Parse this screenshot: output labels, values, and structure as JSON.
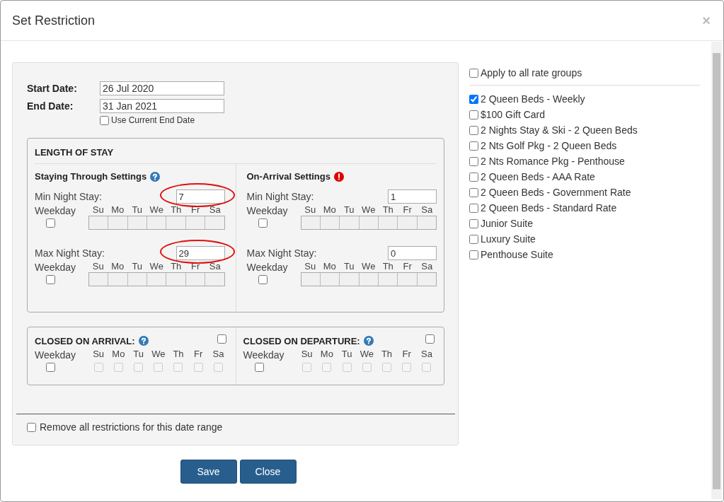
{
  "dialog": {
    "title": "Set Restriction",
    "close": "×"
  },
  "dates": [
    {
      "label": "Start Date:",
      "value": "26 Jul 2020"
    },
    {
      "label": "End Date:",
      "value": "31 Jan 2021"
    }
  ],
  "use_current_end_date": {
    "label": "Use Current End Date",
    "checked": false
  },
  "length_of_stay": {
    "title": "LENGTH OF STAY",
    "columns": [
      {
        "title": "Staying Through Settings",
        "kind": "help",
        "rows": [
          {
            "label": "Min Night Stay:",
            "value": "7",
            "circled": true,
            "weekday_label": "Weekday",
            "weekday_checked": false,
            "days": [
              "Su",
              "Mo",
              "Tu",
              "We",
              "Th",
              "Fr",
              "Sa"
            ]
          },
          {
            "label": "Max Night Stay:",
            "value": "29",
            "circled": true,
            "weekday_label": "Weekday",
            "weekday_checked": false,
            "days": [
              "Su",
              "Mo",
              "Tu",
              "We",
              "Th",
              "Fr",
              "Sa"
            ]
          }
        ]
      },
      {
        "title": "On-Arrival Settings",
        "kind": "alert",
        "rows": [
          {
            "label": "Min Night Stay:",
            "value": "1",
            "circled": false,
            "weekday_label": "Weekday",
            "weekday_checked": false,
            "days": [
              "Su",
              "Mo",
              "Tu",
              "We",
              "Th",
              "Fr",
              "Sa"
            ]
          },
          {
            "label": "Max Night Stay:",
            "value": "0",
            "circled": false,
            "weekday_label": "Weekday",
            "weekday_checked": false,
            "days": [
              "Su",
              "Mo",
              "Tu",
              "We",
              "Th",
              "Fr",
              "Sa"
            ]
          }
        ]
      }
    ]
  },
  "closed": [
    {
      "title": "CLOSED ON ARRIVAL:",
      "checked": false,
      "weekday_label": "Weekday",
      "weekday_checked": false,
      "days": [
        {
          "label": "Su",
          "checked": false,
          "disabled": true
        },
        {
          "label": "Mo",
          "checked": false,
          "disabled": true
        },
        {
          "label": "Tu",
          "checked": false,
          "disabled": true
        },
        {
          "label": "We",
          "checked": false,
          "disabled": true
        },
        {
          "label": "Th",
          "checked": false,
          "disabled": true
        },
        {
          "label": "Fr",
          "checked": false,
          "disabled": true
        },
        {
          "label": "Sa",
          "checked": false,
          "disabled": true
        }
      ]
    },
    {
      "title": "CLOSED ON DEPARTURE:",
      "checked": false,
      "weekday_label": "Weekday",
      "weekday_checked": false,
      "days": [
        {
          "label": "Su",
          "checked": false,
          "disabled": true
        },
        {
          "label": "Mo",
          "checked": false,
          "disabled": true
        },
        {
          "label": "Tu",
          "checked": false,
          "disabled": true
        },
        {
          "label": "We",
          "checked": false,
          "disabled": true
        },
        {
          "label": "Th",
          "checked": false,
          "disabled": true
        },
        {
          "label": "Fr",
          "checked": false,
          "disabled": true
        },
        {
          "label": "Sa",
          "checked": false,
          "disabled": true
        }
      ]
    }
  ],
  "remove_all": {
    "label": "Remove all restrictions for this date range",
    "checked": false
  },
  "buttons": [
    "Save",
    "Close"
  ],
  "rate_groups": {
    "apply_all": {
      "label": "Apply to all rate groups",
      "checked": false
    },
    "items": [
      {
        "label": "2 Queen Beds - Weekly",
        "checked": true
      },
      {
        "label": "$100 Gift Card",
        "checked": false
      },
      {
        "label": "2 Nights Stay & Ski - 2 Queen Beds",
        "checked": false
      },
      {
        "label": "2 Nts Golf Pkg - 2 Queen Beds",
        "checked": false
      },
      {
        "label": "2 Nts Romance Pkg - Penthouse",
        "checked": false
      },
      {
        "label": "2 Queen Beds - AAA Rate",
        "checked": false
      },
      {
        "label": "2 Queen Beds - Government Rate",
        "checked": false
      },
      {
        "label": "2 Queen Beds - Standard Rate",
        "checked": false
      },
      {
        "label": "Junior Suite",
        "checked": false
      },
      {
        "label": "Luxury Suite",
        "checked": false
      },
      {
        "label": "Penthouse Suite",
        "checked": false
      }
    ]
  }
}
